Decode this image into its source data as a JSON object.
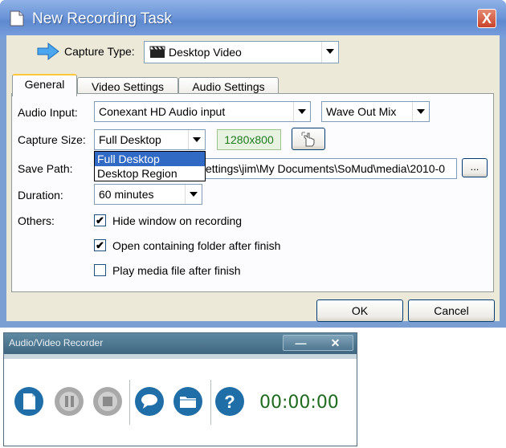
{
  "dialog": {
    "title": "New Recording Task",
    "close_glyph": "X",
    "capture_type": {
      "label": "Capture Type:",
      "value": "Desktop Video"
    },
    "tabs": [
      {
        "label": "General",
        "active": true
      },
      {
        "label": "Video Settings",
        "active": false
      },
      {
        "label": "Audio Settings",
        "active": false
      }
    ],
    "general": {
      "audio_input_label": "Audio Input:",
      "audio_input_value": "Conexant HD Audio input",
      "audio_mix_value": "Wave Out Mix",
      "capture_size_label": "Capture Size:",
      "capture_size_value": "Full Desktop",
      "resolution": "1280x800",
      "capture_size_options": [
        "Full Desktop",
        "Desktop Region"
      ],
      "save_path_label": "Save Path:",
      "save_path_value": "ettings\\jim\\My Documents\\SoMud\\media\\2010-0",
      "browse_label": "...",
      "duration_label": "Duration:",
      "duration_value": "60 minutes",
      "others_label": "Others:",
      "options": [
        {
          "label": "Hide window on recording",
          "checked": true
        },
        {
          "label": "Open containing folder after finish",
          "checked": true
        },
        {
          "label": "Play media file after finish",
          "checked": false
        }
      ]
    },
    "ok_label": "OK",
    "cancel_label": "Cancel"
  },
  "recorder": {
    "title": "Audio/Video Recorder",
    "minimize_glyph": "—",
    "close_glyph": "✕",
    "timer": "00:00:00",
    "buttons": [
      "new-file-icon",
      "pause-icon",
      "stop-icon",
      "comment-icon",
      "folder-icon",
      "help-icon"
    ],
    "help_glyph": "?"
  },
  "colors": {
    "title_bar": "#6b95d8",
    "dialog_face": "#ece9d8",
    "tab_highlight": "#ffc83c",
    "selection": "#316ac5",
    "timer": "#1e6b1e",
    "recorder_button": "#1f6ea8"
  }
}
